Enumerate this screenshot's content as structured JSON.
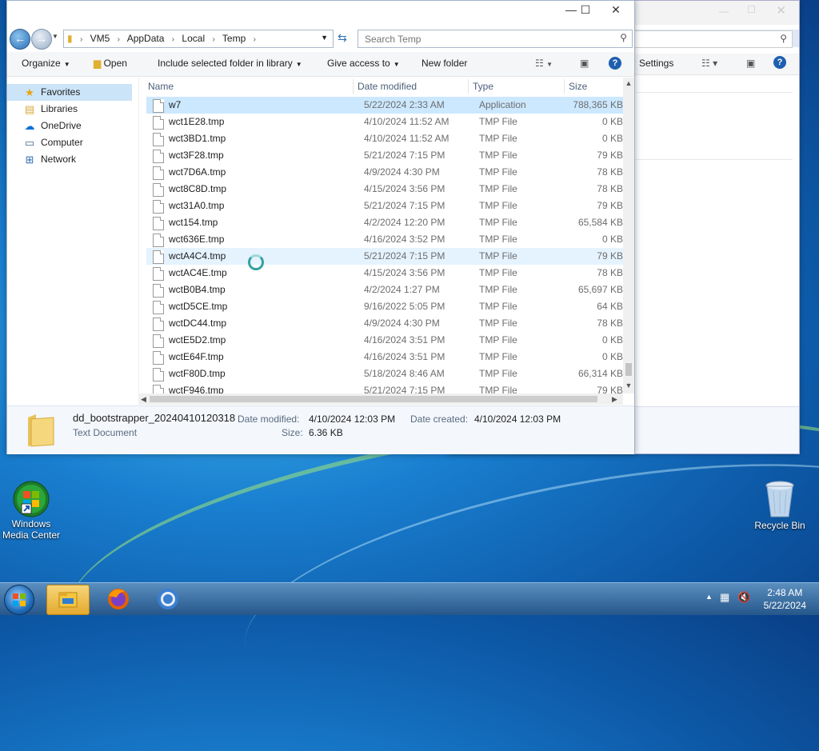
{
  "explorer": {
    "address_crumbs": [
      "VM5",
      "AppData",
      "Local",
      "Temp"
    ],
    "search_placeholder": "Search Temp",
    "toolbar": {
      "organize": "Organize",
      "open": "Open",
      "include": "Include selected folder in library",
      "give_access": "Give access to",
      "new_folder": "New folder"
    },
    "nav": [
      {
        "label": "Favorites",
        "icon": "star-icon"
      },
      {
        "label": "Libraries",
        "icon": "libraries-icon"
      },
      {
        "label": "OneDrive",
        "icon": "cloud-icon"
      },
      {
        "label": "Computer",
        "icon": "computer-icon"
      },
      {
        "label": "Network",
        "icon": "network-icon"
      }
    ],
    "columns": {
      "name": "Name",
      "date": "Date modified",
      "type": "Type",
      "size": "Size"
    },
    "files": [
      {
        "name": "w7",
        "date": "5/22/2024 2:33 AM",
        "type": "Application",
        "size": "788,365 KB"
      },
      {
        "name": "wct1E28.tmp",
        "date": "4/10/2024 11:52 AM",
        "type": "TMP File",
        "size": "0 KB"
      },
      {
        "name": "wct3BD1.tmp",
        "date": "4/10/2024 11:52 AM",
        "type": "TMP File",
        "size": "0 KB"
      },
      {
        "name": "wct3F28.tmp",
        "date": "5/21/2024 7:15 PM",
        "type": "TMP File",
        "size": "79 KB"
      },
      {
        "name": "wct7D6A.tmp",
        "date": "4/9/2024 4:30 PM",
        "type": "TMP File",
        "size": "78 KB"
      },
      {
        "name": "wct8C8D.tmp",
        "date": "4/15/2024 3:56 PM",
        "type": "TMP File",
        "size": "78 KB"
      },
      {
        "name": "wct31A0.tmp",
        "date": "5/21/2024 7:15 PM",
        "type": "TMP File",
        "size": "79 KB"
      },
      {
        "name": "wct154.tmp",
        "date": "4/2/2024 12:20 PM",
        "type": "TMP File",
        "size": "65,584 KB"
      },
      {
        "name": "wct636E.tmp",
        "date": "4/16/2024 3:52 PM",
        "type": "TMP File",
        "size": "0 KB"
      },
      {
        "name": "wctA4C4.tmp",
        "date": "5/21/2024 7:15 PM",
        "type": "TMP File",
        "size": "79 KB"
      },
      {
        "name": "wctAC4E.tmp",
        "date": "4/15/2024 3:56 PM",
        "type": "TMP File",
        "size": "78 KB"
      },
      {
        "name": "wctB0B4.tmp",
        "date": "4/2/2024 1:27 PM",
        "type": "TMP File",
        "size": "65,697 KB"
      },
      {
        "name": "wctD5CE.tmp",
        "date": "9/16/2022 5:05 PM",
        "type": "TMP File",
        "size": "64 KB"
      },
      {
        "name": "wctDC44.tmp",
        "date": "4/9/2024 4:30 PM",
        "type": "TMP File",
        "size": "78 KB"
      },
      {
        "name": "wctE5D2.tmp",
        "date": "4/16/2024 3:51 PM",
        "type": "TMP File",
        "size": "0 KB"
      },
      {
        "name": "wctE64F.tmp",
        "date": "4/16/2024 3:51 PM",
        "type": "TMP File",
        "size": "0 KB"
      },
      {
        "name": "wctF80D.tmp",
        "date": "5/18/2024 8:46 AM",
        "type": "TMP File",
        "size": "66,314 KB"
      },
      {
        "name": "wctF946.tmp",
        "date": "5/21/2024 7:15 PM",
        "type": "TMP File",
        "size": "79 KB"
      }
    ],
    "details": {
      "filename": "dd_bootstrapper_20240410120318",
      "filetype": "Text Document",
      "date_modified_label": "Date modified:",
      "date_modified": "4/10/2024 12:03 PM",
      "date_created_label": "Date created:",
      "date_created": "4/10/2024 12:03 PM",
      "size_label": "Size:",
      "size": "6.36 KB"
    }
  },
  "background_window": {
    "toolbar_text": "Settings"
  },
  "desktop": {
    "media_center": "Windows Media Center",
    "recycle_bin": "Recycle Bin"
  },
  "taskbar": {
    "time": "2:48 AM",
    "date": "5/22/2024"
  }
}
